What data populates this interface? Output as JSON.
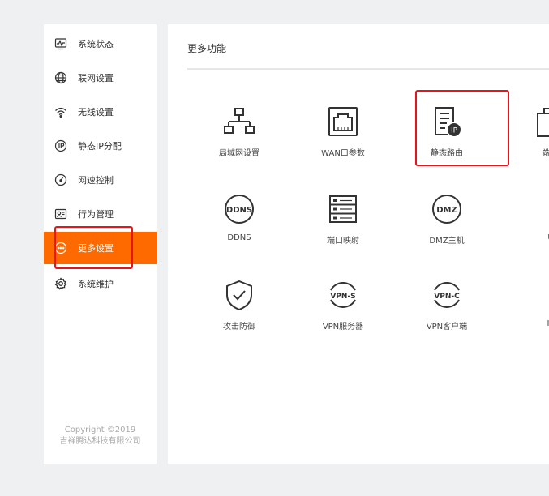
{
  "sidebar": {
    "items": [
      {
        "label": "系统状态",
        "icon": "monitor-pulse-icon"
      },
      {
        "label": "联网设置",
        "icon": "globe-icon"
      },
      {
        "label": "无线设置",
        "icon": "wifi-icon"
      },
      {
        "label": "静态IP分配",
        "icon": "ip-circle-icon"
      },
      {
        "label": "网速控制",
        "icon": "speed-gauge-icon"
      },
      {
        "label": "行为管理",
        "icon": "id-card-icon"
      },
      {
        "label": "更多设置",
        "icon": "more-dots-icon",
        "active": true
      },
      {
        "label": "系统维护",
        "icon": "gear-icon"
      }
    ],
    "copyright_line1": "Copyright ©2019",
    "copyright_line2": "吉祥腾达科技有限公司"
  },
  "main": {
    "title": "更多功能",
    "tiles": [
      {
        "label": "局域网设置",
        "icon": "lan-topology-icon"
      },
      {
        "label": "WAN口参数",
        "icon": "wan-port-icon"
      },
      {
        "label": "静态路由",
        "icon": "static-route-icon"
      },
      {
        "label": "端口",
        "icon": "port-icon"
      },
      {
        "label": "DDNS",
        "icon": "ddns-icon"
      },
      {
        "label": "端口映射",
        "icon": "port-mapping-icon"
      },
      {
        "label": "DMZ主机",
        "icon": "dmz-icon"
      },
      {
        "label": "U",
        "icon": "upnp-icon"
      },
      {
        "label": "攻击防御",
        "icon": "shield-check-icon"
      },
      {
        "label": "VPN服务器",
        "icon": "vpn-server-icon"
      },
      {
        "label": "VPN客户端",
        "icon": "vpn-client-icon"
      },
      {
        "label": "IP",
        "icon": "ip-icon"
      }
    ]
  },
  "colors": {
    "accent": "#ff6a00",
    "highlight": "#e8141a"
  }
}
